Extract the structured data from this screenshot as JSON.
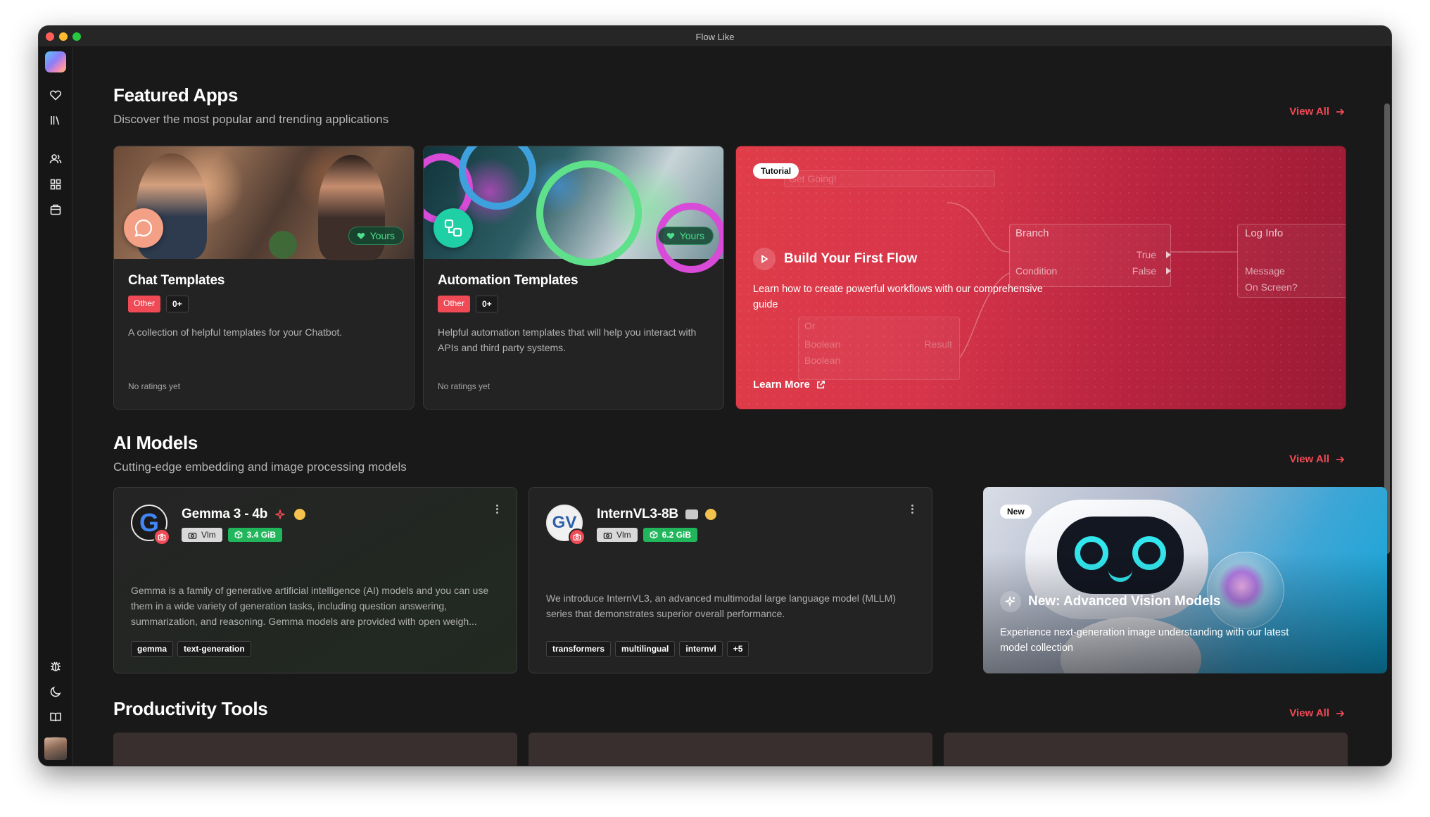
{
  "window": {
    "title": "Flow Like"
  },
  "sidebar": {
    "top_icons": [
      "heart-icon",
      "library-icon",
      "users-icon",
      "grid-icon",
      "store-icon"
    ],
    "bottom_icons": [
      "bug-icon",
      "moon-icon",
      "book-icon",
      "panel-icon"
    ]
  },
  "featured": {
    "title": "Featured Apps",
    "subtitle": "Discover the most popular and trending applications",
    "view_all": "View All",
    "apps": [
      {
        "name": "Chat Templates",
        "category": "Other",
        "age": "0+",
        "owner_badge": "Yours",
        "description": "A collection of helpful templates for your Chatbot.",
        "rating": "No ratings yet"
      },
      {
        "name": "Automation Templates",
        "category": "Other",
        "age": "0+",
        "owner_badge": "Yours",
        "description": "Helpful automation templates that will help you interact with APIs and third party systems.",
        "rating": "No ratings yet"
      }
    ],
    "tutorial": {
      "pill": "Tutorial",
      "title": "Build Your First Flow",
      "description": "Learn how to create powerful workflows with our comprehensive guide",
      "link": "Learn More",
      "nodes": {
        "get_going": "Get Going!",
        "branch": "Branch",
        "condition": "Condition",
        "true_label": "True",
        "false_label": "False",
        "log_info": "Log Info",
        "message": "Message",
        "on_screen": "On Screen?",
        "or_label": "Or",
        "boolean_a": "Boolean",
        "boolean_b": "Boolean",
        "result": "Result"
      }
    }
  },
  "models": {
    "title": "AI Models",
    "subtitle": "Cutting-edge embedding and image processing models",
    "view_all": "View All",
    "items": [
      {
        "name": "Gemma 3 - 4b",
        "type_badge": "Vlm",
        "size": "3.4 GiB",
        "description": "Gemma is a family of generative artificial intelligence (AI) models and you can use them in a wide variety of generation tasks, including question answering, summarization, and reasoning. Gemma models are provided with open weigh...",
        "tags": [
          "gemma",
          "text-generation"
        ]
      },
      {
        "name": "InternVL3-8B",
        "type_badge": "Vlm",
        "size": "6.2 GiB",
        "description": "We introduce InternVL3, an advanced multimodal large language model (MLLM) series that demonstrates superior overall performance.",
        "tags": [
          "transformers",
          "multilingual",
          "internvl",
          "+5"
        ]
      }
    ],
    "promo": {
      "pill": "New",
      "title": "New: Advanced Vision Models",
      "description": "Experience next-generation image understanding with our latest model collection"
    }
  },
  "productivity": {
    "title": "Productivity Tools",
    "view_all": "View All"
  },
  "colors": {
    "accent": "#f04a56",
    "green": "#21b65c",
    "background": "#191919",
    "card": "#232323"
  }
}
